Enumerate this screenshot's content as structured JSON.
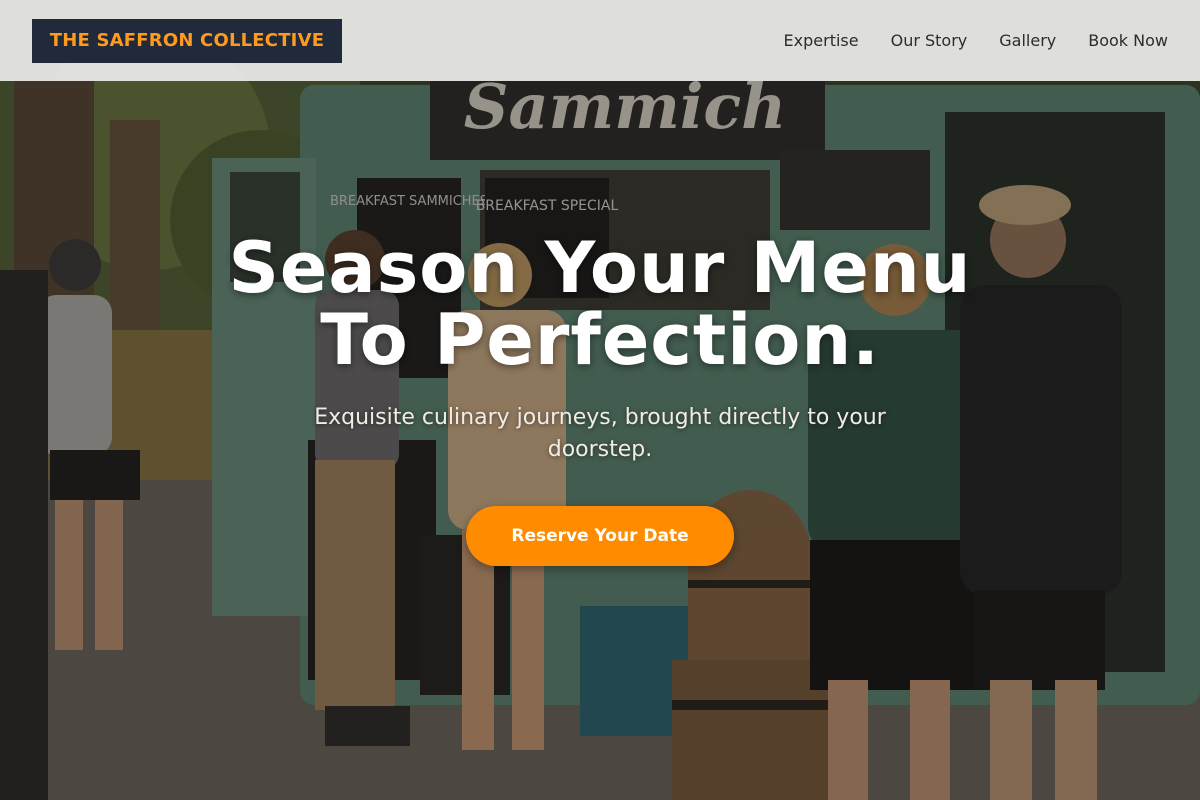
{
  "header": {
    "brand": "THE SAFFRON COLLECTIVE",
    "nav": [
      "Expertise",
      "Our Story",
      "Gallery",
      "Book Now"
    ]
  },
  "hero": {
    "headline_line1": "Season Your Menu",
    "headline_line2": "To Perfection.",
    "subheadline": "Exquisite culinary journeys, brought directly to your doorstep.",
    "cta_label": "Reserve Your Date",
    "truck_sign": "Sammich",
    "board_left": "BREAKFAST SAMMICHES",
    "board_right": "BREAKFAST SPECIAL"
  },
  "colors": {
    "brand_bg": "#212a3b",
    "brand_text": "#ff9a1f",
    "cta_bg": "#ff8c00",
    "header_bg": "#ececea"
  }
}
